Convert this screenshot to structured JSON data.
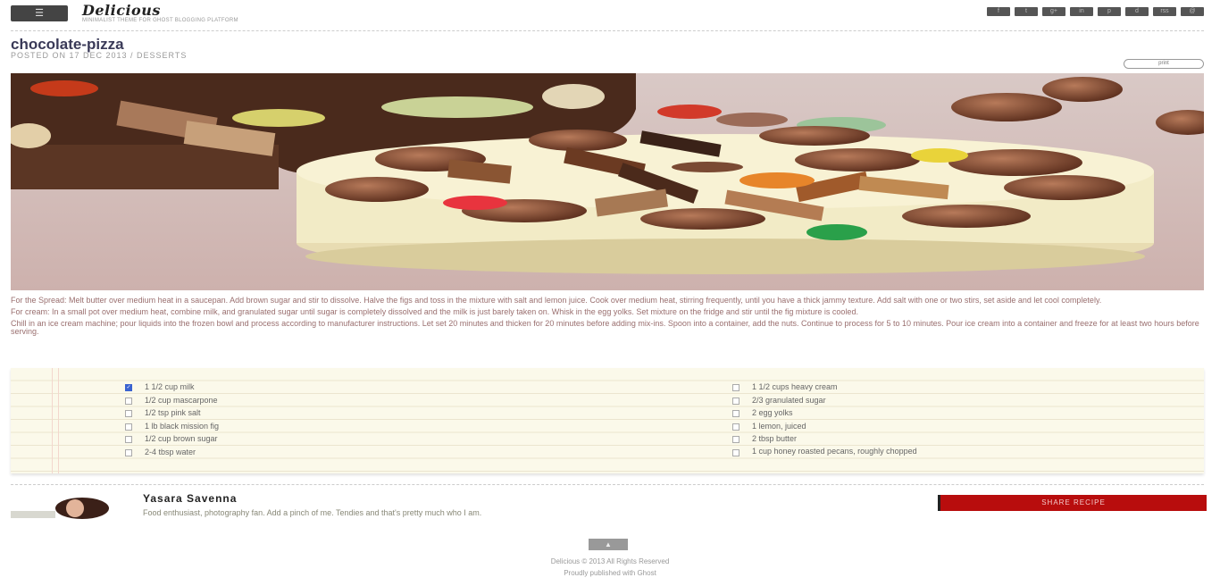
{
  "header": {
    "menu_label": "☰",
    "logo": "Delicious",
    "tagline": "MINIMALIST THEME FOR GHOST BLOGGING PLATFORM",
    "social": [
      "f",
      "t",
      "g+",
      "in",
      "p",
      "d",
      "rss",
      "@"
    ]
  },
  "post": {
    "title": "chocolate-pizza",
    "meta": "POSTED ON 17 DEC 2013 / DESSERTS",
    "print_label": "print",
    "paragraphs": [
      "For the Spread: Melt butter over medium heat in a saucepan. Add brown sugar and stir to dissolve. Halve the figs and toss in the mixture with salt and lemon juice. Cook over medium heat, stirring frequently, until you have a thick jammy texture. Add salt with one or two stirs, set aside and let cool completely.",
      "For cream: In a small pot over medium heat, combine milk, and granulated sugar until sugar is completely dissolved and the milk is just barely taken on. Whisk in the egg yolks. Set mixture on the fridge and stir until the fig mixture is cooled.",
      "Chill in an ice cream machine; pour liquids into the frozen bowl and process according to manufacturer instructions. Let set 20 minutes and thicken for 20 minutes before adding mix-ins. Spoon into a container, add the nuts. Continue to process for 5 to 10 minutes. Pour ice cream into a container and freeze for at least two hours before serving."
    ]
  },
  "ingredients": {
    "left": [
      {
        "label": "1 1/2 cup milk",
        "checked": true
      },
      {
        "label": "1/2 cup mascarpone",
        "checked": false
      },
      {
        "label": "1/2 tsp pink salt",
        "checked": false
      },
      {
        "label": "1 lb black mission fig",
        "checked": false
      },
      {
        "label": "1/2 cup brown sugar",
        "checked": false
      },
      {
        "label": "2-4 tbsp water",
        "checked": false
      }
    ],
    "right": [
      {
        "label": "1 1/2 cups heavy cream",
        "checked": false
      },
      {
        "label": "2/3 granulated sugar",
        "checked": false
      },
      {
        "label": "2 egg yolks",
        "checked": false
      },
      {
        "label": "1 lemon, juiced",
        "checked": false
      },
      {
        "label": "2 tbsp butter",
        "checked": false
      },
      {
        "label": "1 cup honey roasted pecans, roughly chopped",
        "checked": false
      }
    ]
  },
  "author": {
    "name": "Yasara Savenna",
    "bio": "Food enthusiast, photography fan. Add a pinch of me. Tendies and that's pretty much who I am.",
    "share_label": "SHARE RECIPE"
  },
  "footer": {
    "top_label": "▲",
    "copyright": "Delicious © 2013 All Rights Reserved",
    "powered": "Proudly published with Ghost"
  },
  "colors": {
    "title": "#3a3a58",
    "share_bg": "#b80d0d",
    "checkbox_checked": "#3a63d0",
    "paper": "#fbf9ea"
  }
}
